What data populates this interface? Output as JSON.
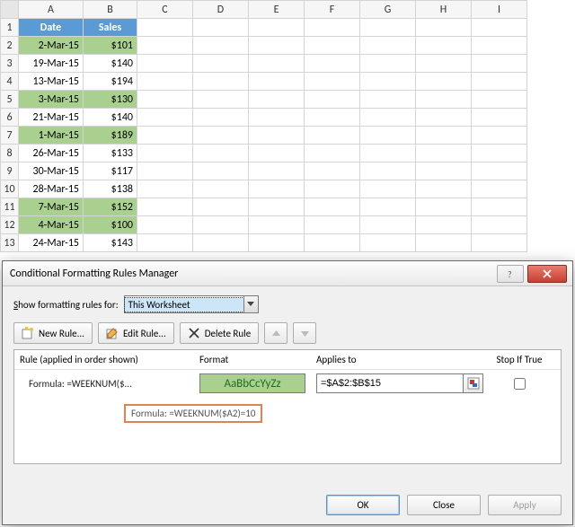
{
  "columns": [
    "A",
    "B",
    "C",
    "D",
    "E",
    "F",
    "G",
    "H",
    "I"
  ],
  "header": {
    "A": "Date",
    "B": "Sales"
  },
  "rows": [
    {
      "n": 1,
      "date": "",
      "sales": ""
    },
    {
      "n": 2,
      "date": "2-Mar-15",
      "sales": "$101",
      "hl": true
    },
    {
      "n": 3,
      "date": "19-Mar-15",
      "sales": "$140",
      "hl": false
    },
    {
      "n": 4,
      "date": "13-Mar-15",
      "sales": "$194",
      "hl": false
    },
    {
      "n": 5,
      "date": "3-Mar-15",
      "sales": "$130",
      "hl": true
    },
    {
      "n": 6,
      "date": "21-Mar-15",
      "sales": "$140",
      "hl": false
    },
    {
      "n": 7,
      "date": "1-Mar-15",
      "sales": "$189",
      "hl": true
    },
    {
      "n": 8,
      "date": "26-Mar-15",
      "sales": "$133",
      "hl": false
    },
    {
      "n": 9,
      "date": "30-Mar-15",
      "sales": "$117",
      "hl": false
    },
    {
      "n": 10,
      "date": "28-Mar-15",
      "sales": "$138",
      "hl": false
    },
    {
      "n": 11,
      "date": "7-Mar-15",
      "sales": "$152",
      "hl": true
    },
    {
      "n": 12,
      "date": "4-Mar-15",
      "sales": "$100",
      "hl": true
    },
    {
      "n": 13,
      "date": "24-Mar-15",
      "sales": "$143",
      "hl": false
    }
  ],
  "dialog": {
    "title": "Conditional Formatting Rules Manager",
    "show_label_pre": "S",
    "show_label_mid": "how formatting rules for:",
    "scope_value": "This Worksheet",
    "new_rule": "New Rule...",
    "edit_rule": "Edit Rule...",
    "delete_rule": "Delete Rule",
    "cols": {
      "rule": "Rule (applied in order shown)",
      "format": "Format",
      "applies": "Applies to",
      "stop": "Stop If True"
    },
    "rule": {
      "label": "Formula: =WEEKNUM($...",
      "preview": "AaBbCcYyZz",
      "applies": "=$A$2:$B$15",
      "stop": false
    },
    "tooltip": "Formula: =WEEKNUM($A2)=10",
    "ok": "OK",
    "close": "Close",
    "apply": "Apply"
  }
}
